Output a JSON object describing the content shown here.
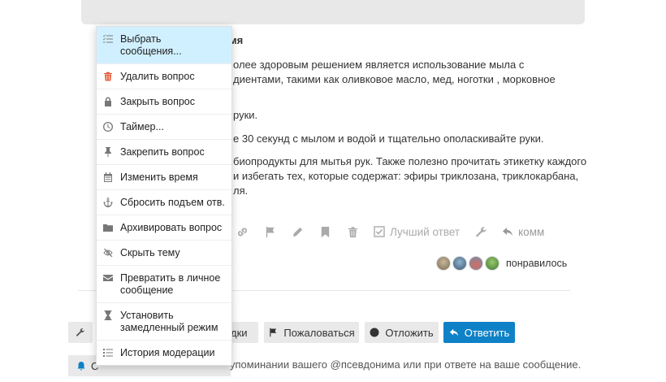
{
  "post": {
    "title_fragment": "мя",
    "line1": "олее здоровым решением является использование мыла с",
    "line2": "диентами, такими как оливковое масло, мед, ноготки , морковное",
    "line3": "руки.",
    "line4": "е 30 секунд с мылом и водой и тщательно ополаскивайте руки.",
    "line5": "биопродукты для мытья рук. Также полезно прочитать этикетку каждого",
    "line6": "и избегать тех, которые содержат: эфиры триклозана, триклокарбана,",
    "line7": "ля."
  },
  "post_actions": {
    "icons": [
      "link-icon",
      "flag-icon",
      "pencil-icon",
      "bookmark-icon",
      "trash-icon"
    ],
    "best_answer_label": "Лучший ответ",
    "reply_label": "комм"
  },
  "likes": {
    "label": "понравилось"
  },
  "footer": {
    "bookmark_label": "дки",
    "flag_label": "Пожаловаться",
    "defer_label": "Отложить",
    "reply_label": "Ответить",
    "notify_label": "С",
    "notify_text": "упоминании вашего @псевдонима или при ответе на ваше сообщение."
  },
  "menu": {
    "items": [
      {
        "label": "Выбрать сообщения...",
        "icon": "select-list-icon"
      },
      {
        "label": "Удалить вопрос",
        "icon": "trash-icon"
      },
      {
        "label": "Закрыть вопрос",
        "icon": "lock-icon"
      },
      {
        "label": "Таймер...",
        "icon": "clock-icon"
      },
      {
        "label": "Закрепить вопрос",
        "icon": "pin-icon"
      },
      {
        "label": "Изменить время",
        "icon": "calendar-icon"
      },
      {
        "label": "Сбросить подъем отв.",
        "icon": "anchor-icon"
      },
      {
        "label": "Архивировать вопрос",
        "icon": "folder-icon"
      },
      {
        "label": "Скрыть тему",
        "icon": "eye-slash-icon"
      },
      {
        "label": "Превратить в личное сообщение",
        "icon": "envelope-icon"
      },
      {
        "label": "Установить замедленный режим",
        "icon": "hourglass-icon"
      },
      {
        "label": "История модерации",
        "icon": "list-icon"
      }
    ]
  },
  "colors": {
    "accent": "#0f81c7",
    "menu_highlight": "#d1f0ff",
    "danger": "#e45735"
  }
}
